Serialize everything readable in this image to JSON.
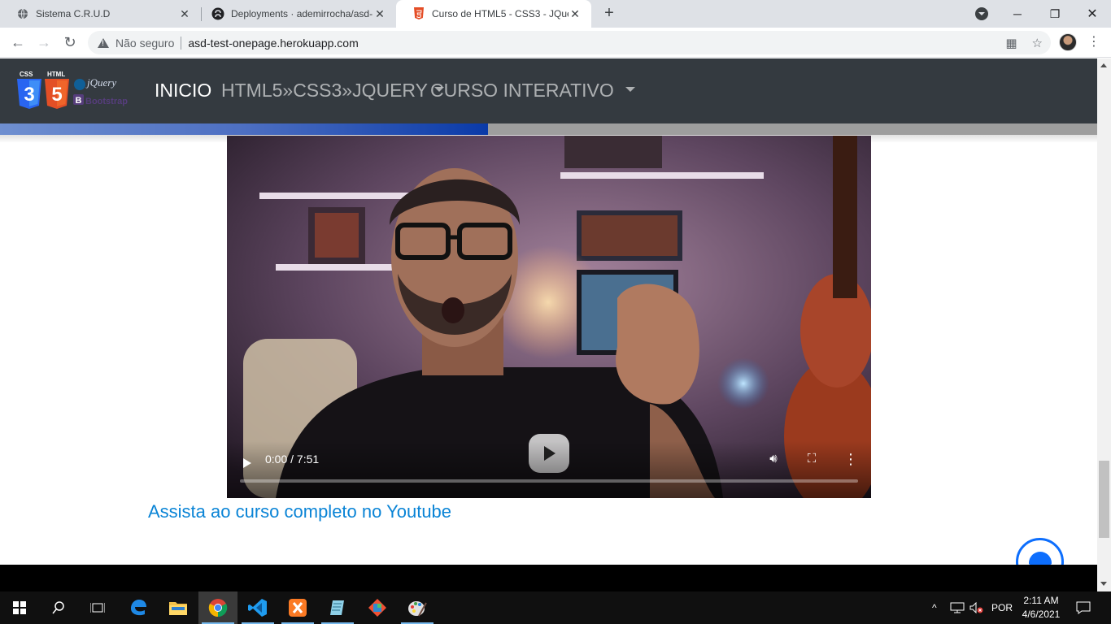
{
  "browser": {
    "tabs": [
      {
        "title": "Sistema C.R.U.D",
        "icon": "globe-icon"
      },
      {
        "title": "Deployments · ademirrocha/asd-",
        "icon": "github-icon"
      },
      {
        "title": "Curso de HTML5 - CSS3 - JQuery",
        "icon": "html5-icon"
      }
    ],
    "security_label": "Não seguro",
    "url": "asd-test-onepage.herokuapp.com"
  },
  "site": {
    "logo": {
      "css_label": "CSS",
      "html_label": "HTML",
      "css_number": "3",
      "html_number": "5",
      "jquery_label": "jQuery",
      "bootstrap_letter": "B",
      "bootstrap_label": "Bootstrap"
    },
    "nav": {
      "inicio": "INICIO",
      "html_menu": "HTML5»CSS3»JQUERY",
      "curso_menu": "CURSO INTERATIVO"
    },
    "scroll_progress_percent": 44.5,
    "colors": {
      "navbar": "#343a40",
      "link": "#0a84d6",
      "accent": "#0d6efd"
    }
  },
  "video": {
    "time": "0:00 / 7:51",
    "played_fraction": 0
  },
  "content": {
    "youtube_link": "Assista ao curso completo no Youtube"
  },
  "taskbar": {
    "apps": [
      "start-icon",
      "search-icon",
      "task-view-icon",
      "edge-icon",
      "file-explorer-icon",
      "chrome-icon",
      "vscode-icon",
      "xampp-icon",
      "notepad-icon",
      "git-icon",
      "paint-icon"
    ],
    "language": "POR",
    "time": "2:11 AM",
    "date": "4/6/2021"
  }
}
